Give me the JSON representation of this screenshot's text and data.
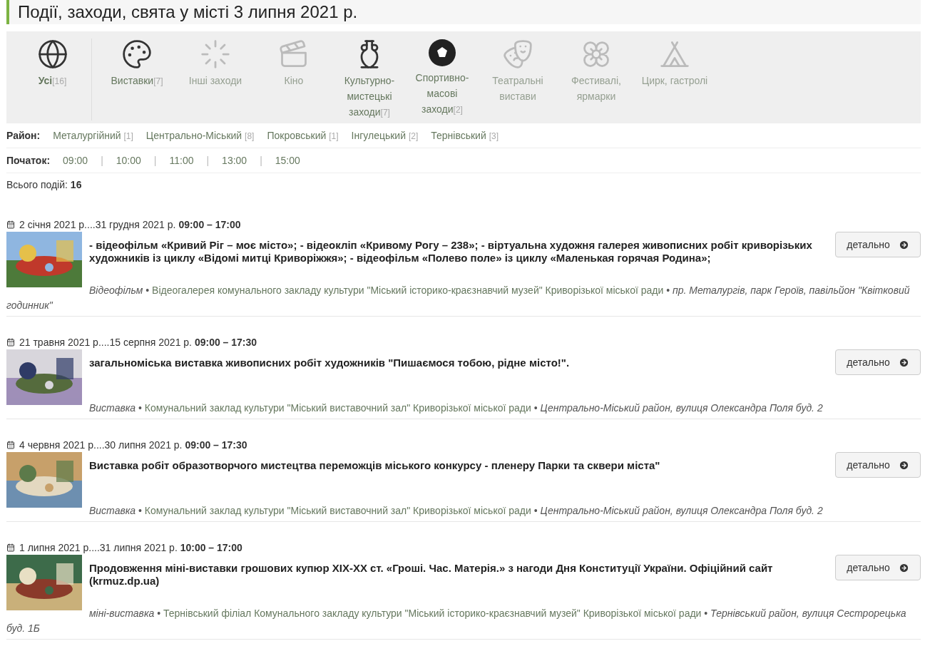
{
  "title": "Події, заходи, свята у місті 3 липня 2021 р.",
  "categories": [
    {
      "label": "Усі",
      "count": "[16]",
      "selected": true,
      "disabled": false
    },
    {
      "label": "Виставки",
      "count": "[7]",
      "selected": false,
      "disabled": false
    },
    {
      "label": "Інші заходи",
      "selected": false,
      "disabled": true
    },
    {
      "label": "Кіно",
      "selected": false,
      "disabled": true
    },
    {
      "label": "Культурно-мистецькі заходи",
      "count": "[7]",
      "selected": false,
      "disabled": false
    },
    {
      "label": "Спортивно-масові заходи",
      "count": "[2]",
      "selected": false,
      "disabled": false
    },
    {
      "label": "Театральні вистави",
      "selected": false,
      "disabled": true
    },
    {
      "label": "Фестивалі, ярмарки",
      "selected": false,
      "disabled": true
    },
    {
      "label": "Цирк, гастролі",
      "selected": false,
      "disabled": true
    }
  ],
  "district": {
    "label": "Район:",
    "items": [
      {
        "name": "Металургійний",
        "count": "[1]"
      },
      {
        "name": "Центрально-Міський",
        "count": "[8]"
      },
      {
        "name": "Покровський",
        "count": "[1]"
      },
      {
        "name": "Інгулецький",
        "count": "[2]"
      },
      {
        "name": "Тернівський",
        "count": "[3]"
      }
    ]
  },
  "start": {
    "label": "Початок:",
    "times": [
      "09:00",
      "10:00",
      "11:00",
      "13:00",
      "15:00"
    ],
    "separator": "|"
  },
  "bullet": "•",
  "total": {
    "label": "Всього подій:",
    "value": "16"
  },
  "events": [
    {
      "dates": "2 січня 2021 р....31 грудня 2021 р.",
      "time": "09:00 – 17:00",
      "title": "- відеофільм «Кривий Ріг – моє місто»; - відеокліп «Кривому Рогу – 238»; - віртуальна художня галерея живописних робіт криворізьких художників із циклу «Відомі митці Криворіжжя»; - відеофільм «Полево поле» із циклу «Маленькая горячая Родина»;",
      "type": "Відеофільм",
      "venue": "Відеогалерея комунального закладу культури \"Міський історико-краєзнавчий музей\" Криворізької міської ради",
      "address": "пр. Металургів, парк Героїв, павільйон \"Квітковий годинник\"",
      "button": "детально"
    },
    {
      "dates": "21 травня 2021 р....15 серпня 2021 р.",
      "time": "09:00 – 17:30",
      "title": "загальноміська виставка живописних робіт художників \"Пишаємося тобою, рідне місто!\".",
      "type": "Виставка",
      "venue": "Комунальний заклад культури \"Міський виставочний зал\" Криворізької міської ради",
      "address": "Центрально-Міський район, вулиця Олександра Поля буд. 2",
      "button": "детально"
    },
    {
      "dates": "4 червня 2021 р....30 липня 2021 р.",
      "time": "09:00 – 17:30",
      "title": "Виставка робіт образотворчого мистецтва переможців міського конкурсу - пленеру Парки та сквери міста\"",
      "type": "Виставка",
      "venue": "Комунальний заклад культури \"Міський виставочний зал\" Криворізької міської ради",
      "address": "Центрально-Міський район, вулиця Олександра Поля буд. 2",
      "button": "детально"
    },
    {
      "dates": "1 липня 2021 р....31 липня 2021 р.",
      "time": "10:00 – 17:00",
      "title": "Продовження міні-виставки грошових купюр XIX-XX ст. «Гроші. Час. Матерія.» з нагоди Дня Конституції України. Офіційний сайт (krmuz.dp.ua)",
      "type": "міні-виставка",
      "venue": "Тернівський філіал Комунального закладу культури \"Міський історико-краєзнавчий музей\" Криворізької міської ради",
      "address": "Тернівський район, вулиця Сестрорецька буд. 1Б",
      "button": "детально"
    }
  ]
}
